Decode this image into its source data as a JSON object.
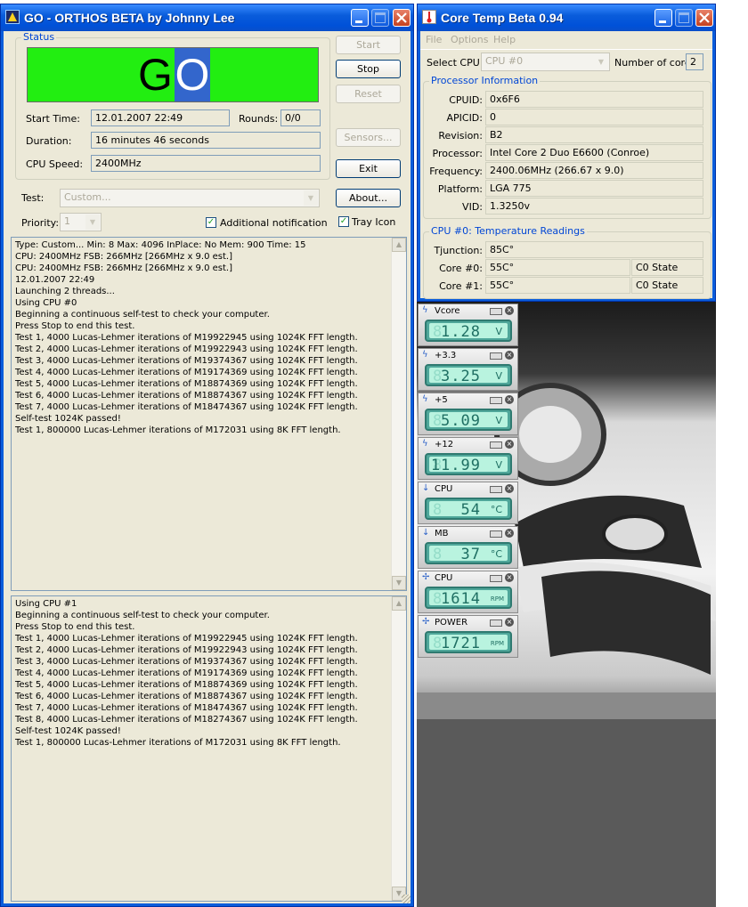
{
  "orthos": {
    "title": "GO - ORTHOS BETA by Johnny Lee",
    "status_group": "Status",
    "status_text": {
      "g": "G",
      "o": "O"
    },
    "colors": {
      "status_bg": "#22ee11",
      "highlight": "#3366cc"
    },
    "start_time_label": "Start Time:",
    "start_time_value": "12.01.2007 22:49",
    "rounds_label": "Rounds:",
    "rounds_value": "0/0",
    "duration_label": "Duration:",
    "duration_value": "16 minutes 46 seconds",
    "cpu_speed_label": "CPU Speed:",
    "cpu_speed_value": "2400MHz",
    "buttons": {
      "start": "Start",
      "stop": "Stop",
      "reset": "Reset",
      "sensors": "Sensors...",
      "exit": "Exit",
      "about": "About..."
    },
    "test_label": "Test:",
    "test_value": "Custom...",
    "priority_label": "Priority:",
    "priority_value": "1",
    "additional_notification": "Additional notification",
    "tray_icon": "Tray Icon",
    "log1": [
      "Type: Custom... Min: 8 Max: 4096 InPlace: No Mem: 900 Time: 15",
      "CPU: 2400MHz FSB: 266MHz [266MHz x 9.0 est.]",
      "CPU: 2400MHz FSB: 266MHz [266MHz x 9.0 est.]",
      "12.01.2007 22:49",
      "Launching 2 threads...",
      "Using CPU #0",
      "Beginning a continuous self-test to check your computer.",
      "Press Stop to end this test.",
      "Test 1, 4000 Lucas-Lehmer iterations of M19922945 using 1024K FFT length.",
      "Test 2, 4000 Lucas-Lehmer iterations of M19922943 using 1024K FFT length.",
      "Test 3, 4000 Lucas-Lehmer iterations of M19374367 using 1024K FFT length.",
      "Test 4, 4000 Lucas-Lehmer iterations of M19174369 using 1024K FFT length.",
      "Test 5, 4000 Lucas-Lehmer iterations of M18874369 using 1024K FFT length.",
      "Test 6, 4000 Lucas-Lehmer iterations of M18874367 using 1024K FFT length.",
      "Test 7, 4000 Lucas-Lehmer iterations of M18474367 using 1024K FFT length.",
      "Self-test 1024K passed!",
      "Test 1, 800000 Lucas-Lehmer iterations of M172031 using 8K FFT length."
    ],
    "log2": [
      "Using CPU #1",
      "Beginning a continuous self-test to check your computer.",
      "Press Stop to end this test.",
      "Test 1, 4000 Lucas-Lehmer iterations of M19922945 using 1024K FFT length.",
      "Test 2, 4000 Lucas-Lehmer iterations of M19922943 using 1024K FFT length.",
      "Test 3, 4000 Lucas-Lehmer iterations of M19374367 using 1024K FFT length.",
      "Test 4, 4000 Lucas-Lehmer iterations of M19174369 using 1024K FFT length.",
      "Test 5, 4000 Lucas-Lehmer iterations of M18874369 using 1024K FFT length.",
      "Test 6, 4000 Lucas-Lehmer iterations of M18874367 using 1024K FFT length.",
      "Test 7, 4000 Lucas-Lehmer iterations of M18474367 using 1024K FFT length.",
      "Test 8, 4000 Lucas-Lehmer iterations of M18274367 using 1024K FFT length.",
      "Self-test 1024K passed!",
      "Test 1, 800000 Lucas-Lehmer iterations of M172031 using 8K FFT length."
    ]
  },
  "coretemp": {
    "title": "Core Temp Beta 0.94",
    "menu": [
      "File",
      "Options",
      "Help"
    ],
    "select_cpu_label": "Select CPU:",
    "select_cpu_value": "CPU #0",
    "cores_label": "Number of cores",
    "cores_value": "2",
    "proc_group": "Processor Information",
    "cpuid_label": "CPUID:",
    "cpuid_value": "0x6F6",
    "apicid_label": "APICID:",
    "apicid_value": "0",
    "revision_label": "Revision:",
    "revision_value": "B2",
    "processor_label": "Processor:",
    "processor_value": "Intel Core 2 Duo E6600 (Conroe)",
    "frequency_label": "Frequency:",
    "frequency_value": "2400.06MHz (266.67 x 9.0)",
    "platform_label": "Platform:",
    "platform_value": "LGA 775",
    "vid_label": "VID:",
    "vid_value": "1.3250v",
    "temp_group": "CPU #0: Temperature Readings",
    "tjunction_label": "Tjunction:",
    "tjunction_value": "85C°",
    "core0_label": "Core #0:",
    "core0_value": "55C°",
    "core0_state": "C0 State",
    "core1_label": "Core #1:",
    "core1_value": "55C°",
    "core1_state": "C0 State"
  },
  "gadgets": [
    {
      "label": "Vcore",
      "icon": "voltage-icon",
      "value": "1.28",
      "unit": "V"
    },
    {
      "label": "+3.3",
      "icon": "voltage-icon",
      "value": "3.25",
      "unit": "V"
    },
    {
      "label": "+5",
      "icon": "voltage-icon",
      "value": "5.09",
      "unit": "V"
    },
    {
      "label": "+12",
      "icon": "voltage-icon",
      "value": "11.99",
      "unit": "V"
    },
    {
      "label": "CPU",
      "icon": "thermometer-icon",
      "value": "54",
      "unit": "°C"
    },
    {
      "label": "MB",
      "icon": "thermometer-icon",
      "value": "37",
      "unit": "°C"
    },
    {
      "label": "CPU",
      "icon": "fan-icon",
      "value": "1614",
      "unit": "RPM"
    },
    {
      "label": "POWER",
      "icon": "fan-icon",
      "value": "1721",
      "unit": "RPM"
    }
  ]
}
